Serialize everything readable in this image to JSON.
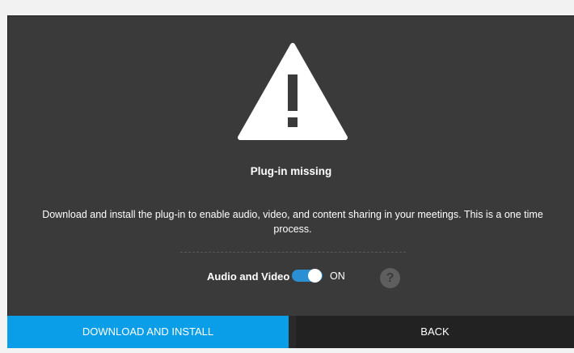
{
  "dialog": {
    "title": "Plug-in missing",
    "description": "Download and install the plug-in to enable audio, video, and content sharing in your meetings. This is a one time process.",
    "audio_video_label": "Audio and Video",
    "toggle_state": "ON",
    "toggle_on": true,
    "help_glyph": "?",
    "icons": {
      "warning": "warning-triangle-icon",
      "help": "question-mark-icon"
    }
  },
  "actions": {
    "primary_label": "DOWNLOAD AND INSTALL",
    "secondary_label": "BACK"
  },
  "colors": {
    "background": "#3a3a3a",
    "accent": "#0b9ee8",
    "toggle_on": "#2b8fd3",
    "secondary_button": "#222222"
  }
}
